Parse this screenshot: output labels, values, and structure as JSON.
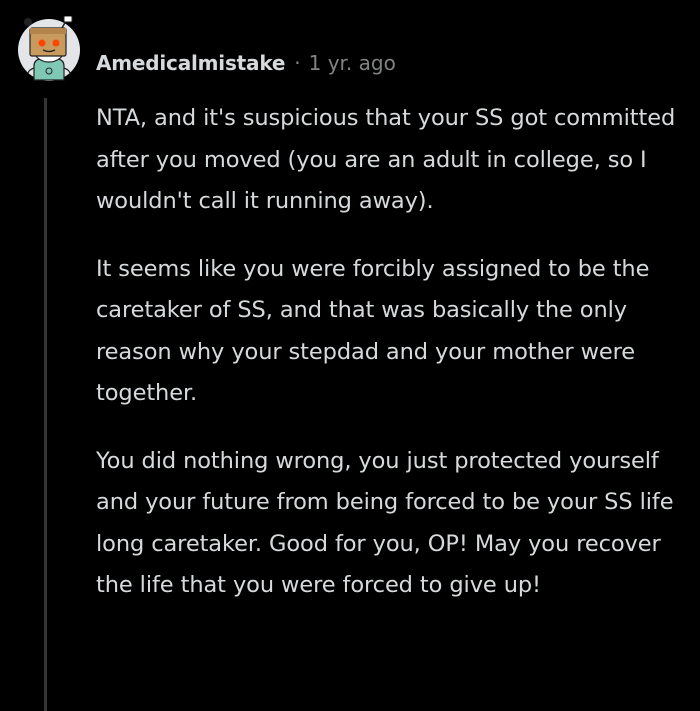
{
  "comment": {
    "username": "Amedicalmistake",
    "separator": "·",
    "timestamp": "1 yr. ago",
    "avatar_icon": "snoo-avatar-icon",
    "paragraphs": [
      "NTA, and it's suspicious that your SS got committed after you moved (you are an adult in college, so I wouldn't call it running away).",
      "It seems like you were forcibly assigned to be the caretaker of SS, and that was basically the only reason why your stepdad and your mother were together.",
      "You did nothing wrong, you just protected yourself and your future from being forced to be your SS life long caretaker. Good for you, OP! May you recover the life that you were forced to give up!"
    ]
  },
  "colors": {
    "background": "#000000",
    "text": "#d7dadc",
    "meta": "#818384",
    "thread_line": "#343536"
  }
}
